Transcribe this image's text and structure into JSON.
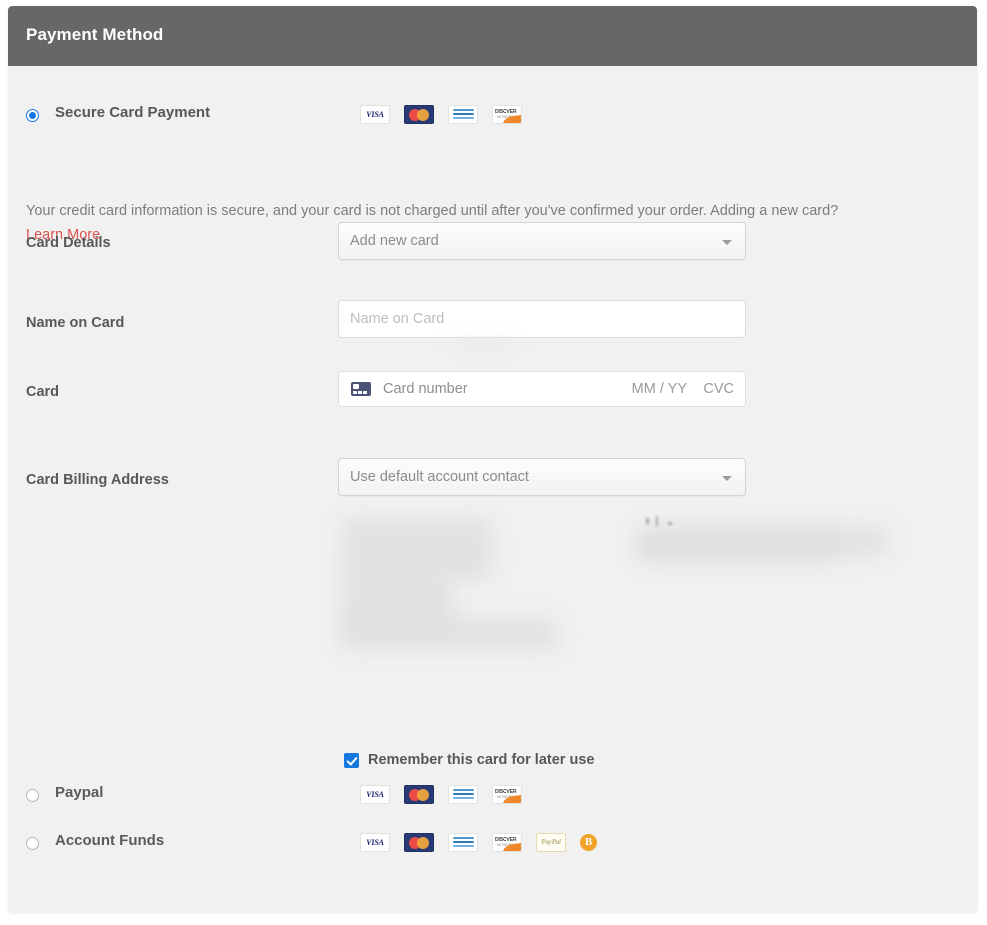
{
  "header": {
    "title": "Payment Method"
  },
  "colors": {
    "header_bg": "#676767",
    "panel_bg": "#f1f1f1",
    "accent_blue": "#1478e0",
    "link_red": "#d9534f",
    "label_gray": "#585858",
    "muted_gray": "#7d7d7d"
  },
  "options": {
    "secure_card": {
      "label": "Secure Card Payment",
      "selected": true,
      "brands": [
        "visa-icon",
        "mastercard-icon",
        "amex-icon",
        "discover-icon"
      ]
    },
    "paypal": {
      "label": "Paypal",
      "selected": false,
      "brands": [
        "visa-icon",
        "mastercard-icon",
        "amex-icon",
        "discover-icon"
      ]
    },
    "account_funds": {
      "label": "Account Funds",
      "selected": false,
      "brands": [
        "visa-icon",
        "mastercard-icon",
        "amex-icon",
        "discover-icon",
        "paypal-icon",
        "bitcoin-icon"
      ]
    }
  },
  "description": {
    "text": "Your credit card information is secure, and your card is not charged until after you've confirmed your order. Adding a new card?",
    "link_label": "Learn More"
  },
  "fields": {
    "card_details": {
      "label": "Card Details",
      "value": "Add new card"
    },
    "name_on_card": {
      "label": "Name on Card",
      "value": "",
      "placeholder": "Name on Card"
    },
    "card": {
      "label": "Card",
      "number_placeholder": "Card number",
      "expiry_placeholder": "MM / YY",
      "cvc_placeholder": "CVC"
    },
    "billing_address": {
      "label": "Card Billing Address",
      "value": "Use default account contact"
    }
  },
  "remember_card": {
    "label": "Remember this card for later use",
    "checked": true
  },
  "brand_text": {
    "visa": "VISA",
    "discover_main": "DISCVER",
    "discover_sub": "NETWORK",
    "paypal": "PayPal",
    "bitcoin": "B"
  }
}
